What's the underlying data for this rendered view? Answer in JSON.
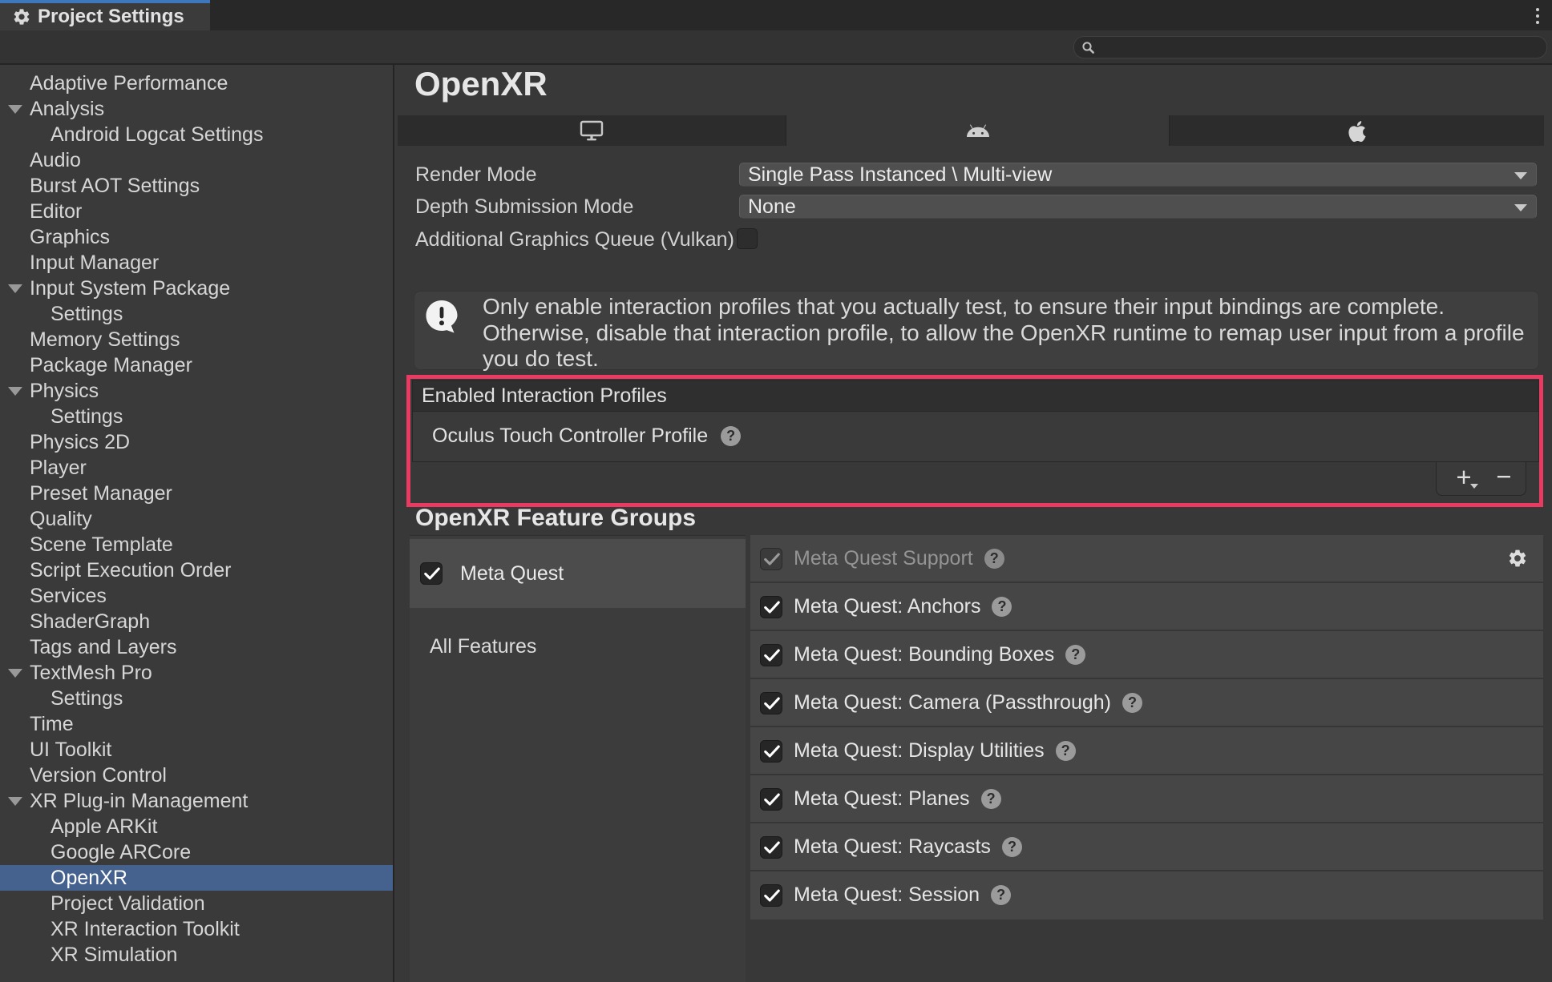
{
  "window": {
    "tab_title": "Project Settings"
  },
  "search": {
    "value": "",
    "placeholder": ""
  },
  "colors": {
    "accent_blue": "#3e77bb",
    "selection_blue": "#45618e",
    "annotation_pink": "#e93a62"
  },
  "sidebar": {
    "items": [
      {
        "label": "Adaptive Performance",
        "level": 0
      },
      {
        "label": "Analysis",
        "level": 0,
        "foldout": true
      },
      {
        "label": "Android Logcat Settings",
        "level": 1
      },
      {
        "label": "Audio",
        "level": 0
      },
      {
        "label": "Burst AOT Settings",
        "level": 0
      },
      {
        "label": "Editor",
        "level": 0
      },
      {
        "label": "Graphics",
        "level": 0
      },
      {
        "label": "Input Manager",
        "level": 0
      },
      {
        "label": "Input System Package",
        "level": 0,
        "foldout": true
      },
      {
        "label": "Settings",
        "level": 1
      },
      {
        "label": "Memory Settings",
        "level": 0
      },
      {
        "label": "Package Manager",
        "level": 0
      },
      {
        "label": "Physics",
        "level": 0,
        "foldout": true
      },
      {
        "label": "Settings",
        "level": 1
      },
      {
        "label": "Physics 2D",
        "level": 0
      },
      {
        "label": "Player",
        "level": 0
      },
      {
        "label": "Preset Manager",
        "level": 0
      },
      {
        "label": "Quality",
        "level": 0
      },
      {
        "label": "Scene Template",
        "level": 0
      },
      {
        "label": "Script Execution Order",
        "level": 0
      },
      {
        "label": "Services",
        "level": 0
      },
      {
        "label": "ShaderGraph",
        "level": 0
      },
      {
        "label": "Tags and Layers",
        "level": 0
      },
      {
        "label": "TextMesh Pro",
        "level": 0,
        "foldout": true
      },
      {
        "label": "Settings",
        "level": 1
      },
      {
        "label": "Time",
        "level": 0
      },
      {
        "label": "UI Toolkit",
        "level": 0
      },
      {
        "label": "Version Control",
        "level": 0
      },
      {
        "label": "XR Plug-in Management",
        "level": 0,
        "foldout": true
      },
      {
        "label": "Apple ARKit",
        "level": 1
      },
      {
        "label": "Google ARCore",
        "level": 1
      },
      {
        "label": "OpenXR",
        "level": 1,
        "selected": true
      },
      {
        "label": "Project Validation",
        "level": 1
      },
      {
        "label": "XR Interaction Toolkit",
        "level": 1
      },
      {
        "label": "XR Simulation",
        "level": 1
      }
    ]
  },
  "main": {
    "title": "OpenXR",
    "platform_tabs": [
      {
        "icon": "monitor-icon",
        "selected": false
      },
      {
        "icon": "android-icon",
        "selected": true
      },
      {
        "icon": "apple-icon",
        "selected": false
      }
    ],
    "form": {
      "render_mode": {
        "label": "Render Mode",
        "value": "Single Pass Instanced \\ Multi-view"
      },
      "depth_submission_mode": {
        "label": "Depth Submission Mode",
        "value": "None"
      },
      "additional_graphics_queue": {
        "label": "Additional Graphics Queue (Vulkan)",
        "checked": false
      }
    },
    "warning": {
      "lines": [
        "Only enable interaction profiles that you actually test, to ensure their input bindings are complete.",
        "Otherwise, disable that interaction profile, to allow the OpenXR runtime to remap user input from a profile",
        "you do test."
      ]
    },
    "interaction_profiles": {
      "header": "Enabled Interaction Profiles",
      "items": [
        {
          "label": "Oculus Touch Controller Profile"
        }
      ],
      "add_label": "+",
      "remove_label": "−"
    },
    "feature_groups": {
      "heading": "OpenXR Feature Groups",
      "groups": [
        {
          "label": "Meta Quest",
          "checked": true,
          "selected": true
        }
      ],
      "all_features_label": "All Features",
      "features": [
        {
          "label": "Meta Quest Support",
          "checked": true,
          "disabled": true,
          "has_gear": true
        },
        {
          "label": "Meta Quest: Anchors",
          "checked": true
        },
        {
          "label": "Meta Quest: Bounding Boxes",
          "checked": true
        },
        {
          "label": "Meta Quest: Camera (Passthrough)",
          "checked": true
        },
        {
          "label": "Meta Quest: Display Utilities",
          "checked": true
        },
        {
          "label": "Meta Quest: Planes",
          "checked": true
        },
        {
          "label": "Meta Quest: Raycasts",
          "checked": true
        },
        {
          "label": "Meta Quest: Session",
          "checked": true
        }
      ]
    }
  }
}
